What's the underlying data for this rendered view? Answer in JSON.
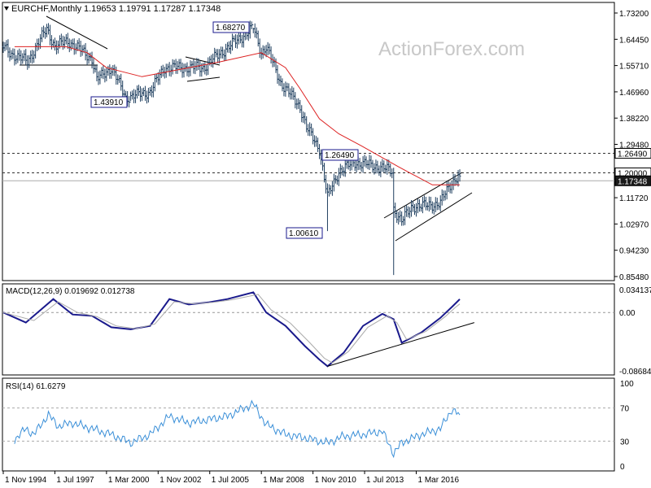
{
  "header": {
    "symbol_label": "EURCHF,Monthly",
    "ohlc": "1.19653 1.19791 1.17287 1.17348"
  },
  "watermark": "ActionForex.com",
  "colors": {
    "price_bars": "#1f3f5f",
    "ma": "#dd2222",
    "macd": "#1a1a8c",
    "signal": "#aaaaaa",
    "rsi": "#3a8fd8",
    "current_price_box": "#1a1a1a"
  },
  "chart_data": [
    {
      "type": "bar",
      "title": "EURCHF,Monthly",
      "ohlc_text": "1.19653 1.19791 1.17287 1.17348",
      "y_ticks": [
        "1.73200",
        "1.64450",
        "1.55710",
        "1.46960",
        "1.38220",
        "1.29480",
        "1.20730",
        "1.11720",
        "1.02970",
        "0.94230",
        "0.85480"
      ],
      "ylim": [
        0.8548,
        1.732
      ],
      "price_series": [
        {
          "date": "1994-11",
          "value": 1.62
        },
        {
          "date": "1995-03",
          "value": 1.6
        },
        {
          "date": "1996-02",
          "value": 1.57
        },
        {
          "date": "1997-02",
          "value": 1.68
        },
        {
          "date": "1997-07",
          "value": 1.62
        },
        {
          "date": "1998-03",
          "value": 1.64
        },
        {
          "date": "1999-06",
          "value": 1.58
        },
        {
          "date": "1999-09",
          "value": 1.51
        },
        {
          "date": "2000-06",
          "value": 1.55
        },
        {
          "date": "2001-03",
          "value": 1.45
        },
        {
          "date": "2002-06",
          "value": 1.47
        },
        {
          "date": "2003-03",
          "value": 1.55
        },
        {
          "date": "2004-06",
          "value": 1.55
        },
        {
          "date": "2005-03",
          "value": 1.55
        },
        {
          "date": "2006-02",
          "value": 1.6
        },
        {
          "date": "2007-10",
          "value": 1.6827
        },
        {
          "date": "2008-03",
          "value": 1.6
        },
        {
          "date": "2008-06",
          "value": 1.62
        },
        {
          "date": "2009-03",
          "value": 1.5
        },
        {
          "date": "2010-03",
          "value": 1.42
        },
        {
          "date": "2010-07",
          "value": 1.35
        },
        {
          "date": "2011-03",
          "value": 1.28
        },
        {
          "date": "2011-08",
          "value": 1.12
        },
        {
          "date": "2012-03",
          "value": 1.205
        },
        {
          "date": "2013-01",
          "value": 1.235
        },
        {
          "date": "2014-04",
          "value": 1.22
        },
        {
          "date": "2014-12",
          "value": 1.205
        },
        {
          "date": "2015-01",
          "value": 1.08
        },
        {
          "date": "2015-06",
          "value": 1.04
        },
        {
          "date": "2016-01",
          "value": 1.09
        },
        {
          "date": "2016-09",
          "value": 1.09
        },
        {
          "date": "2017-06",
          "value": 1.1
        },
        {
          "date": "2018-01",
          "value": 1.17
        },
        {
          "date": "2018-05",
          "value": 1.19
        },
        {
          "date": "2018-06",
          "value": 1.17348
        }
      ],
      "ma_series": [
        {
          "date": "1995-06",
          "value": 1.62
        },
        {
          "date": "1998-02",
          "value": 1.62
        },
        {
          "date": "1999-03",
          "value": 1.6
        },
        {
          "date": "2000-03",
          "value": 1.55
        },
        {
          "date": "2002-01",
          "value": 1.52
        },
        {
          "date": "2004-06",
          "value": 1.55
        },
        {
          "date": "2006-02",
          "value": 1.57
        },
        {
          "date": "2008-03",
          "value": 1.6
        },
        {
          "date": "2009-06",
          "value": 1.55
        },
        {
          "date": "2010-03",
          "value": 1.48
        },
        {
          "date": "2011-03",
          "value": 1.38
        },
        {
          "date": "2012-03",
          "value": 1.33
        },
        {
          "date": "2013-05",
          "value": 1.29
        },
        {
          "date": "2015-04",
          "value": 1.22
        },
        {
          "date": "2017-01",
          "value": 1.16
        },
        {
          "date": "2018-06",
          "value": 1.16
        }
      ],
      "labels": [
        {
          "text": "1.68270",
          "date": "2007-10",
          "value": 1.6827
        },
        {
          "text": "1.43910",
          "date": "2001-06",
          "value": 1.4391
        },
        {
          "text": "1.26490",
          "date": "2011-06",
          "value": 1.2649
        },
        {
          "text": "1.00610",
          "date": "2011-08",
          "value": 1.0061
        }
      ],
      "levels": [
        {
          "value": 1.2649,
          "text": "1.26490",
          "style": "dashed",
          "box": "white"
        },
        {
          "value": 1.2,
          "text": "1.20000",
          "style": "dashed",
          "box": "white"
        },
        {
          "value": 1.17348,
          "text": "1.17348",
          "style": "solid",
          "box": "black"
        }
      ]
    },
    {
      "type": "line",
      "title": "MACD(12,26,9) 0.019692 0.012738",
      "y_ticks": [
        "0.034137",
        "0.00",
        "-0.086849"
      ],
      "ylim": [
        -0.086849,
        0.034137
      ],
      "series": [
        {
          "role": "macd",
          "points": [
            {
              "date": "1994-11",
              "value": 0.0
            },
            {
              "date": "1996-01",
              "value": -0.015
            },
            {
              "date": "1997-06",
              "value": 0.02
            },
            {
              "date": "1998-06",
              "value": -0.003
            },
            {
              "date": "1999-06",
              "value": -0.005
            },
            {
              "date": "2000-06",
              "value": -0.022
            },
            {
              "date": "2001-06",
              "value": -0.025
            },
            {
              "date": "2002-06",
              "value": -0.02
            },
            {
              "date": "2003-06",
              "value": 0.02
            },
            {
              "date": "2004-06",
              "value": 0.012
            },
            {
              "date": "2005-06",
              "value": 0.015
            },
            {
              "date": "2006-06",
              "value": 0.02
            },
            {
              "date": "2007-10",
              "value": 0.03
            },
            {
              "date": "2008-06",
              "value": 0.0
            },
            {
              "date": "2009-06",
              "value": -0.02
            },
            {
              "date": "2010-06",
              "value": -0.05
            },
            {
              "date": "2011-03",
              "value": -0.07
            },
            {
              "date": "2011-08",
              "value": -0.08
            },
            {
              "date": "2012-06",
              "value": -0.06
            },
            {
              "date": "2013-06",
              "value": -0.02
            },
            {
              "date": "2014-06",
              "value": -0.002
            },
            {
              "date": "2015-01",
              "value": -0.01
            },
            {
              "date": "2015-06",
              "value": -0.045
            },
            {
              "date": "2016-06",
              "value": -0.03
            },
            {
              "date": "2017-06",
              "value": -0.008
            },
            {
              "date": "2018-01",
              "value": 0.008
            },
            {
              "date": "2018-06",
              "value": 0.019692
            }
          ]
        },
        {
          "role": "signal",
          "points": [
            {
              "date": "1994-11",
              "value": 0.0
            },
            {
              "date": "1996-06",
              "value": -0.012
            },
            {
              "date": "1997-09",
              "value": 0.016
            },
            {
              "date": "1998-09",
              "value": 0.0
            },
            {
              "date": "1999-09",
              "value": -0.006
            },
            {
              "date": "2000-09",
              "value": -0.02
            },
            {
              "date": "2001-09",
              "value": -0.024
            },
            {
              "date": "2002-09",
              "value": -0.017
            },
            {
              "date": "2003-09",
              "value": 0.016
            },
            {
              "date": "2004-09",
              "value": 0.013
            },
            {
              "date": "2005-09",
              "value": 0.015
            },
            {
              "date": "2006-09",
              "value": 0.019
            },
            {
              "date": "2008-01",
              "value": 0.027
            },
            {
              "date": "2008-09",
              "value": 0.004
            },
            {
              "date": "2009-09",
              "value": -0.016
            },
            {
              "date": "2010-09",
              "value": -0.045
            },
            {
              "date": "2011-06",
              "value": -0.068
            },
            {
              "date": "2011-11",
              "value": -0.075
            },
            {
              "date": "2012-09",
              "value": -0.058
            },
            {
              "date": "2013-09",
              "value": -0.022
            },
            {
              "date": "2014-09",
              "value": -0.005
            },
            {
              "date": "2015-03",
              "value": -0.015
            },
            {
              "date": "2015-09",
              "value": -0.04
            },
            {
              "date": "2016-09",
              "value": -0.028
            },
            {
              "date": "2017-09",
              "value": -0.006
            },
            {
              "date": "2018-03",
              "value": 0.007
            },
            {
              "date": "2018-06",
              "value": 0.012738
            }
          ]
        }
      ],
      "trendline": [
        {
          "date": "2011-08",
          "value": -0.08
        },
        {
          "date": "2019-03",
          "value": -0.015
        }
      ]
    },
    {
      "type": "line",
      "title": "RSI(14) 61.6279",
      "y_ticks": [
        "100",
        "70",
        "30",
        "0"
      ],
      "ylim": [
        0,
        100
      ],
      "levels": [
        70,
        30
      ],
      "series": [
        {
          "role": "rsi",
          "points": [
            {
              "date": "1995-06",
              "value": 32
            },
            {
              "date": "1996-01",
              "value": 45
            },
            {
              "date": "1996-06",
              "value": 38
            },
            {
              "date": "1997-03",
              "value": 62
            },
            {
              "date": "1997-09",
              "value": 48
            },
            {
              "date": "1998-06",
              "value": 52
            },
            {
              "date": "1999-06",
              "value": 45
            },
            {
              "date": "2000-06",
              "value": 38
            },
            {
              "date": "2001-06",
              "value": 28
            },
            {
              "date": "2002-06",
              "value": 38
            },
            {
              "date": "2003-06",
              "value": 60
            },
            {
              "date": "2004-06",
              "value": 52
            },
            {
              "date": "2005-06",
              "value": 56
            },
            {
              "date": "2006-06",
              "value": 60
            },
            {
              "date": "2007-10",
              "value": 75
            },
            {
              "date": "2008-06",
              "value": 50
            },
            {
              "date": "2009-06",
              "value": 38
            },
            {
              "date": "2010-06",
              "value": 34
            },
            {
              "date": "2011-08",
              "value": 28
            },
            {
              "date": "2012-06",
              "value": 36
            },
            {
              "date": "2013-06",
              "value": 38
            },
            {
              "date": "2014-06",
              "value": 42
            },
            {
              "date": "2015-01",
              "value": 15
            },
            {
              "date": "2015-06",
              "value": 28
            },
            {
              "date": "2016-06",
              "value": 38
            },
            {
              "date": "2017-06",
              "value": 45
            },
            {
              "date": "2018-01",
              "value": 68
            },
            {
              "date": "2018-06",
              "value": 61.6279
            }
          ]
        }
      ]
    }
  ],
  "x_axis": {
    "tick_labels": [
      {
        "text": "1 Nov 1994",
        "date": "1994-11"
      },
      {
        "text": "1 Jul 1997",
        "date": "1997-07"
      },
      {
        "text": "1 Mar 2000",
        "date": "2000-03"
      },
      {
        "text": "1 Nov 2002",
        "date": "2002-11"
      },
      {
        "text": "1 Jul 2005",
        "date": "2005-07"
      },
      {
        "text": "1 Mar 2008",
        "date": "2008-03"
      },
      {
        "text": "1 Nov 2010",
        "date": "2010-11"
      },
      {
        "text": "1 Jul 2013",
        "date": "2013-07"
      },
      {
        "text": "1 Mar 2016",
        "date": "2016-03"
      }
    ]
  }
}
